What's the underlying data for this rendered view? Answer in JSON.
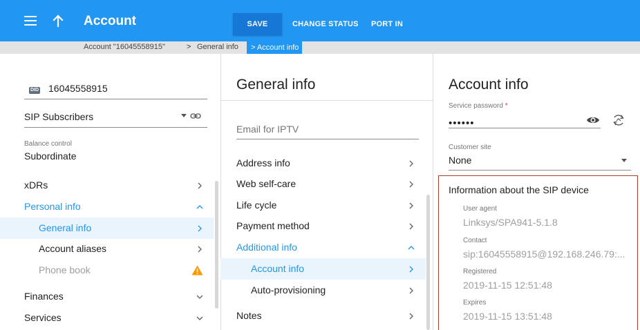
{
  "header": {
    "title": "Account",
    "save_label": "SAVE",
    "change_status_label": "CHANGE STATUS",
    "port_in_label": "PORT IN"
  },
  "breadcrumb": {
    "item1": "Account \"16045558915\"",
    "sep": ">",
    "item2": "General info",
    "item3": "Account info"
  },
  "left": {
    "did_badge": "DID",
    "did_number": "16045558915",
    "product": "SIP Subscribers",
    "balance_label": "Balance control",
    "balance_value": "Subordinate",
    "nav": {
      "xdrs": "xDRs",
      "personal_info": "Personal info",
      "general_info": "General info",
      "account_aliases": "Account aliases",
      "phone_book": "Phone book",
      "finances": "Finances",
      "services": "Services"
    }
  },
  "middle": {
    "title": "General info",
    "email_iptv_placeholder": "Email for IPTV",
    "nav": {
      "address_info": "Address info",
      "web_self_care": "Web self-care",
      "life_cycle": "Life cycle",
      "payment_method": "Payment method",
      "additional_info": "Additional info",
      "account_info": "Account info",
      "auto_provisioning": "Auto-provisioning",
      "notes": "Notes"
    }
  },
  "right": {
    "title": "Account info",
    "service_password_label": "Service password",
    "required_mark": "*",
    "service_password_value": "••••••",
    "customer_site_label": "Customer site",
    "customer_site_value": "None",
    "sip_box": {
      "heading": "Information about the SIP device",
      "user_agent_label": "User agent",
      "user_agent_value": "Linksys/SPA941-5.1.8",
      "contact_label": "Contact",
      "contact_value": "sip:16045558915@192.168.246.79:...",
      "registered_label": "Registered",
      "registered_value": "2019-11-15 12:51:48",
      "expires_label": "Expires",
      "expires_value": "2019-11-15 13:51:48"
    }
  },
  "colors": {
    "accent": "#2196f3",
    "warning": "#ff9800",
    "highlight_border": "#a63c2c",
    "selected_bg": "#e9f4fd"
  }
}
